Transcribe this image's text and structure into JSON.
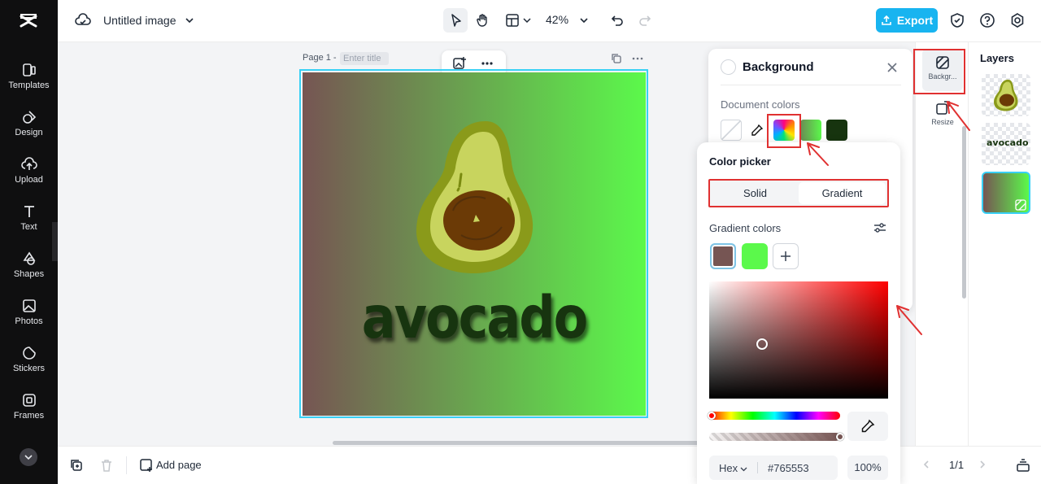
{
  "app": {
    "document_title": "Untitled image",
    "zoom": "42%",
    "export_label": "Export"
  },
  "sidebar": {
    "items": [
      {
        "label": "Templates",
        "icon": "templates-icon"
      },
      {
        "label": "Design",
        "icon": "design-icon"
      },
      {
        "label": "Upload",
        "icon": "upload-icon"
      },
      {
        "label": "Text",
        "icon": "text-icon"
      },
      {
        "label": "Shapes",
        "icon": "shapes-icon"
      },
      {
        "label": "Photos",
        "icon": "photos-icon"
      },
      {
        "label": "Stickers",
        "icon": "stickers-icon"
      },
      {
        "label": "Frames",
        "icon": "frames-icon"
      }
    ]
  },
  "canvas": {
    "page_label": "Page 1 -",
    "title_placeholder": "Enter title",
    "text": "avocado",
    "gradient_start": "#765553",
    "gradient_end": "#5bf94b"
  },
  "bottom_bar": {
    "add_page_label": "Add page",
    "page_indicator": "1/1"
  },
  "background_panel": {
    "title": "Background",
    "document_colors_label": "Document colors",
    "swatches": [
      "none",
      "eyedropper",
      "rainbow",
      "#5aa845",
      "#17340f"
    ]
  },
  "color_picker": {
    "title": "Color picker",
    "tabs": [
      "Solid",
      "Gradient"
    ],
    "active_tab": "Gradient",
    "gradient_colors_label": "Gradient colors",
    "stops": [
      "#765553",
      "#5bf94b"
    ],
    "format_label": "Hex",
    "hex_value": "#765553",
    "opacity": "100",
    "opacity_unit": "%"
  },
  "right_tools": {
    "items": [
      {
        "label": "Backgr...",
        "icon": "background-icon"
      },
      {
        "label": "Resize",
        "icon": "resize-icon"
      }
    ]
  },
  "layers": {
    "title": "Layers",
    "items": [
      "avocado-image",
      "avocado-text",
      "background"
    ]
  }
}
